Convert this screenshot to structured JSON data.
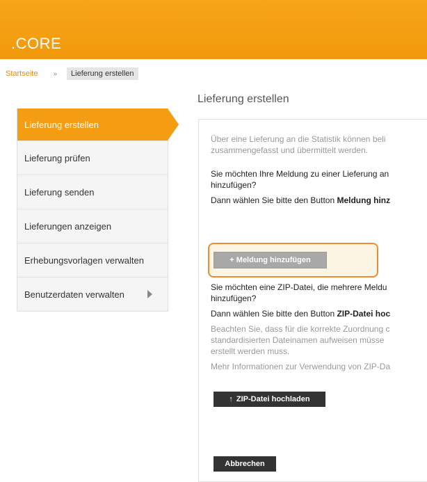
{
  "app": {
    "logo": ".CORE"
  },
  "breadcrumb": {
    "home": "Startseite",
    "separator": "»",
    "current": "Lieferung erstellen"
  },
  "page": {
    "title": "Lieferung erstellen"
  },
  "sidebar": {
    "items": [
      {
        "label": "Lieferung erstellen"
      },
      {
        "label": "Lieferung prüfen"
      },
      {
        "label": "Lieferung senden"
      },
      {
        "label": "Lieferungen anzeigen"
      },
      {
        "label": "Erhebungsvorlagen verwalten"
      },
      {
        "label": "Benutzerdaten verwalten"
      }
    ]
  },
  "content": {
    "intro_line1": "Über eine Lieferung an die Statistik können beli",
    "intro_line2": "zusammengefasst und übermittelt werden.",
    "q1_line1": "Sie möchten Ihre Meldung zu einer Lieferung an",
    "q1_line2": "hinzufügen?",
    "q1_hint_prefix": "Dann wählen Sie bitte den Button ",
    "q1_hint_bold": "Meldung hinz",
    "btn_add_report": "+ Meldung hinzufügen",
    "q2_line1": "Sie möchten eine ZIP-Datei, die mehrere Meldu",
    "q2_line2": "hinzufügen?",
    "q2_hint_prefix": "Dann wählen Sie bitte den Button ",
    "q2_hint_bold": "ZIP-Datei hoc",
    "note_line1": "Beachten Sie, dass für die korrekte Zuordnung c",
    "note_line2": "standardisierten Dateinamen aufweisen müsse",
    "note_line3": "erstellt werden muss.",
    "more_info": "Mehr Informationen zur Verwendung von ZIP-Da",
    "btn_zip_upload": "ZIP-Datei hochladen",
    "btn_cancel": "Abbrechen"
  },
  "colors": {
    "brand": "#f49c12",
    "highlight_border": "#f08c30"
  }
}
